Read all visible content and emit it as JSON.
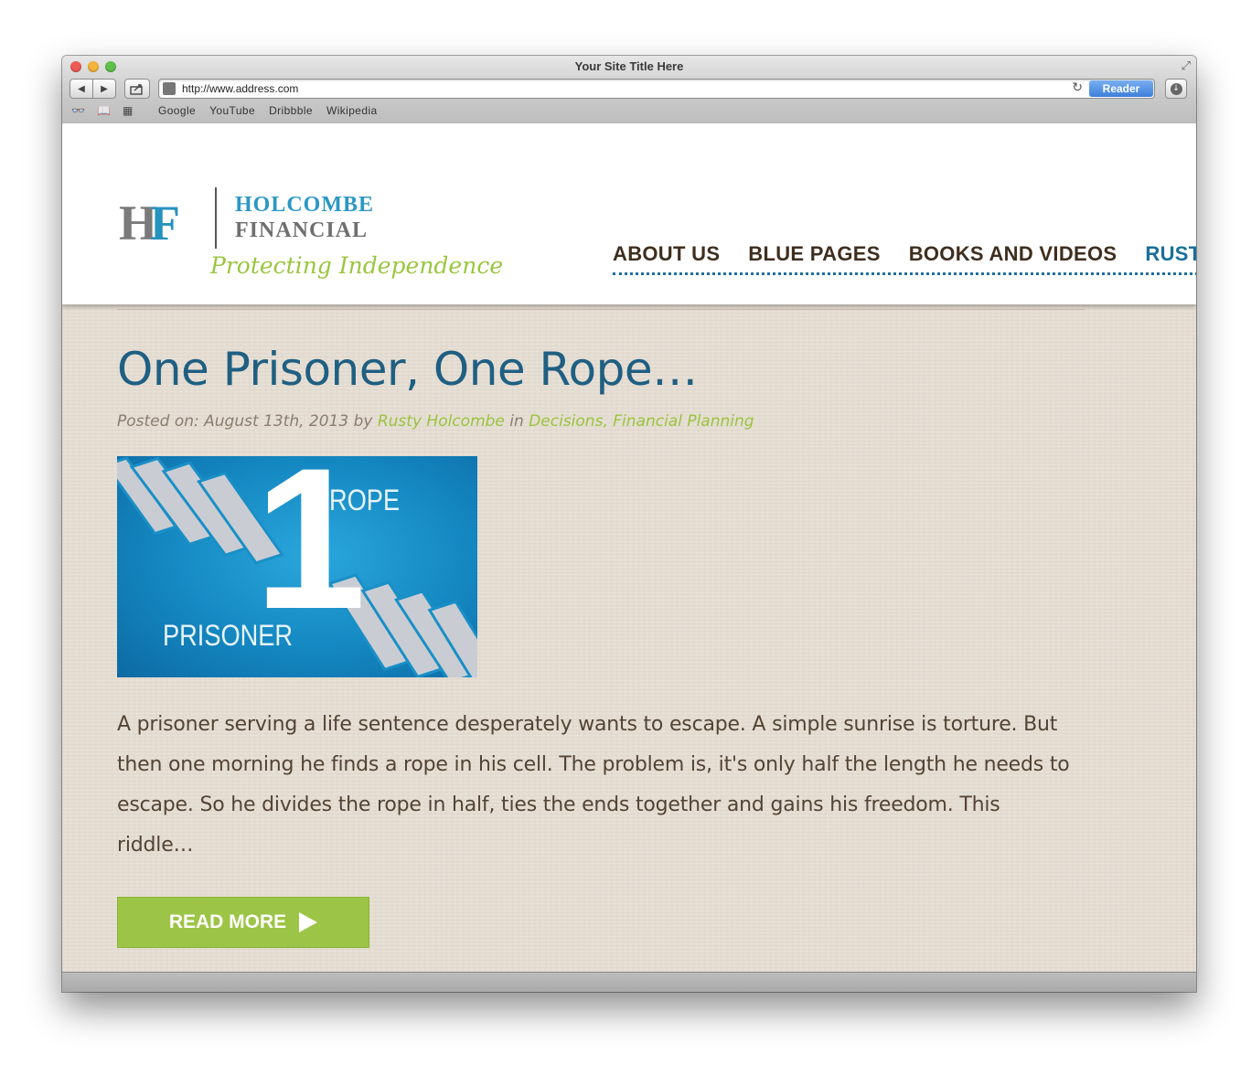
{
  "browser": {
    "window_title": "Your Site Title Here",
    "url": "http://www.address.com",
    "reader_label": "Reader",
    "bookmarks": [
      "Google",
      "YouTube",
      "Dribbble",
      "Wikipedia"
    ]
  },
  "header": {
    "logo_mark_h": "H",
    "logo_mark_f": "F",
    "logo_line1": "HOLCOMBE",
    "logo_line2": "FINANCIAL",
    "tagline": "Protecting Independence",
    "nav": [
      "ABOUT US",
      "BLUE PAGES",
      "BOOKS AND VIDEOS",
      "RUST"
    ]
  },
  "post": {
    "title": "One Prisoner, One Rope…",
    "meta_prefix": "Posted on: August 13th, 2013 by",
    "author": "Rusty Holcombe",
    "meta_in": "in",
    "category1": "Decisions",
    "meta_comma": ",",
    "category2": "Financial Planning",
    "image": {
      "number": "1",
      "word_top": "ROPE",
      "word_bottom": "PRISONER"
    },
    "excerpt": "A prisoner serving a life sentence desperately wants to escape. A simple sunrise is torture. But then one morning he finds a rope in his cell. The problem is, it's only half the length he needs to escape. So he divides the rope in half, ties the ends together and gains his freedom. This riddle…",
    "read_more_label": "READ MORE"
  },
  "colors": {
    "brand_blue": "#1f5f82",
    "accent_green": "#9cc446",
    "nav_brown": "#3f2e1e"
  }
}
